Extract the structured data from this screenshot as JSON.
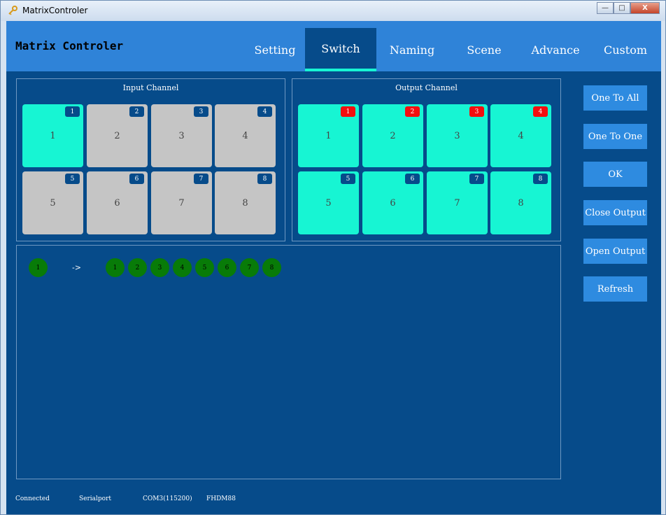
{
  "window": {
    "title": "MatrixControler",
    "minimize_label": "—",
    "maximize_label": "□",
    "close_label": "X"
  },
  "app": {
    "name": "Matrix Controler"
  },
  "tabs": [
    {
      "label": "Setting"
    },
    {
      "label": "Switch"
    },
    {
      "label": "Naming"
    },
    {
      "label": "Scene"
    },
    {
      "label": "Advance"
    },
    {
      "label": "Custom"
    }
  ],
  "input_panel": {
    "title": "Input Channel",
    "cells": [
      {
        "label": "1",
        "badge": "1"
      },
      {
        "label": "2",
        "badge": "2"
      },
      {
        "label": "3",
        "badge": "3"
      },
      {
        "label": "4",
        "badge": "4"
      },
      {
        "label": "5",
        "badge": "5"
      },
      {
        "label": "6",
        "badge": "6"
      },
      {
        "label": "7",
        "badge": "7"
      },
      {
        "label": "8",
        "badge": "8"
      }
    ]
  },
  "output_panel": {
    "title": "Output Channel",
    "cells": [
      {
        "label": "1",
        "badge": "1"
      },
      {
        "label": "2",
        "badge": "2"
      },
      {
        "label": "3",
        "badge": "3"
      },
      {
        "label": "4",
        "badge": "4"
      },
      {
        "label": "5",
        "badge": "5"
      },
      {
        "label": "6",
        "badge": "6"
      },
      {
        "label": "7",
        "badge": "7"
      },
      {
        "label": "8",
        "badge": "8"
      }
    ]
  },
  "side_buttons": {
    "one_to_all": "One To All",
    "one_to_one": "One To One",
    "ok": "OK",
    "close_output": "Close Output",
    "open_output": "Open Output",
    "refresh": "Refresh"
  },
  "mapping": {
    "input": "1",
    "arrow": "->",
    "outputs": [
      "1",
      "2",
      "3",
      "4",
      "5",
      "6",
      "7",
      "8"
    ]
  },
  "status": {
    "connection": "Connected",
    "port_type": "Serialport",
    "port": "COM3(115200)",
    "device": "FHDM88"
  },
  "colors": {
    "selected_cell": "#17f5d3",
    "unselected_cell": "#c5c5c5",
    "active_output_badge": "#f40e0e",
    "badge": "#064b8a",
    "mapping_dot": "#087b08"
  }
}
